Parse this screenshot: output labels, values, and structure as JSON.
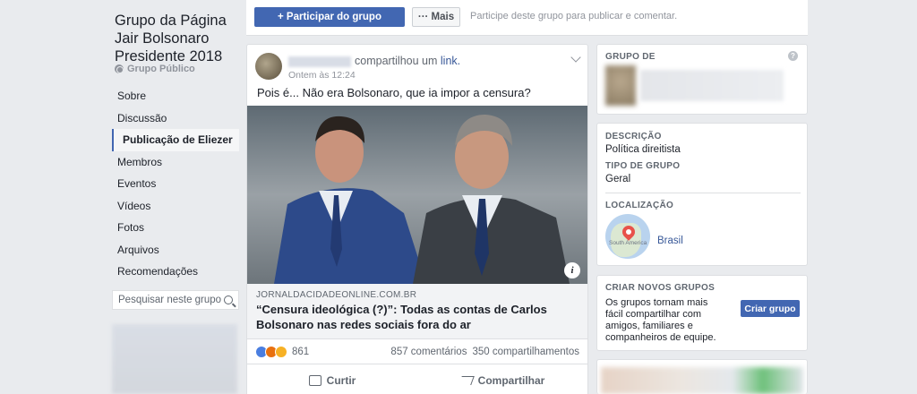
{
  "group": {
    "name": "Grupo da Página Jair Bolsonaro Presidente 2018",
    "type": "Grupo Público"
  },
  "sidebar": {
    "items": [
      {
        "label": "Sobre",
        "active": false
      },
      {
        "label": "Discussão",
        "active": false
      },
      {
        "label": "Publicação de Eliezer",
        "active": true
      },
      {
        "label": "Membros",
        "active": false
      },
      {
        "label": "Eventos",
        "active": false
      },
      {
        "label": "Vídeos",
        "active": false
      },
      {
        "label": "Fotos",
        "active": false
      },
      {
        "label": "Arquivos",
        "active": false
      },
      {
        "label": "Recomendações",
        "active": false
      }
    ],
    "search_placeholder": "Pesquisar neste grupo"
  },
  "topbar": {
    "join_label": "+ Participar do grupo",
    "more_label": "··· Mais",
    "message": "Participe deste grupo para publicar e comentar."
  },
  "post": {
    "shared_text": "compartilhou um",
    "shared_link": "link.",
    "timestamp": "Ontem às 12:24",
    "text": "Pois é... Não era Bolsonaro, que ia impor a censura?",
    "link_domain": "JORNALDACIDADEONLINE.COM.BR",
    "link_headline": "“Censura ideológica (?)”: Todas as contas de Carlos Bolsonaro nas redes sociais fora do ar",
    "reaction_count": "861",
    "comments": "857 comentários",
    "shares": "350 compartilhamentos",
    "like_label": "Curtir",
    "share_label": "Compartilhar"
  },
  "right": {
    "group_of_label": "GRUPO DE",
    "description_label": "DESCRIÇÃO",
    "description_value": "Política direitista",
    "group_type_label": "TIPO DE GRUPO",
    "group_type_value": "Geral",
    "location_label": "LOCALIZAÇÃO",
    "location_value": "Brasil",
    "map_text": "South America",
    "create_label": "CRIAR NOVOS GRUPOS",
    "create_text": "Os grupos tornam mais fácil compartilhar com amigos, familiares e companheiros de equipe.",
    "create_button": "Criar grupo"
  },
  "colors": {
    "brand": "#4267b2",
    "link": "#385898",
    "background": "#e9ebee"
  }
}
